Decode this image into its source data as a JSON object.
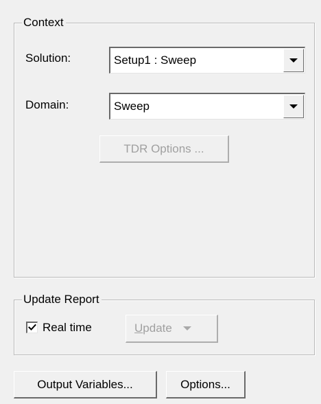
{
  "context": {
    "group_label": "Context",
    "solution_label": "Solution:",
    "solution_value": "Setup1 : Sweep",
    "domain_label": "Domain:",
    "domain_value": "Sweep",
    "tdr_options_label": "TDR Options ..."
  },
  "update_report": {
    "group_label": "Update Report",
    "realtime_label": "Real time",
    "realtime_checked": true,
    "update_label_mnemonic": "U",
    "update_label_rest": "pdate"
  },
  "footer": {
    "output_variables_label": "Output Variables...",
    "options_label": "Options..."
  },
  "icons": {
    "dropdown": "triangle-down-icon",
    "check": "checkmark-icon"
  },
  "colors": {
    "background": "#f0f0f0",
    "disabled_text": "#a0a0a0",
    "group_border": "#b9b9b9"
  }
}
